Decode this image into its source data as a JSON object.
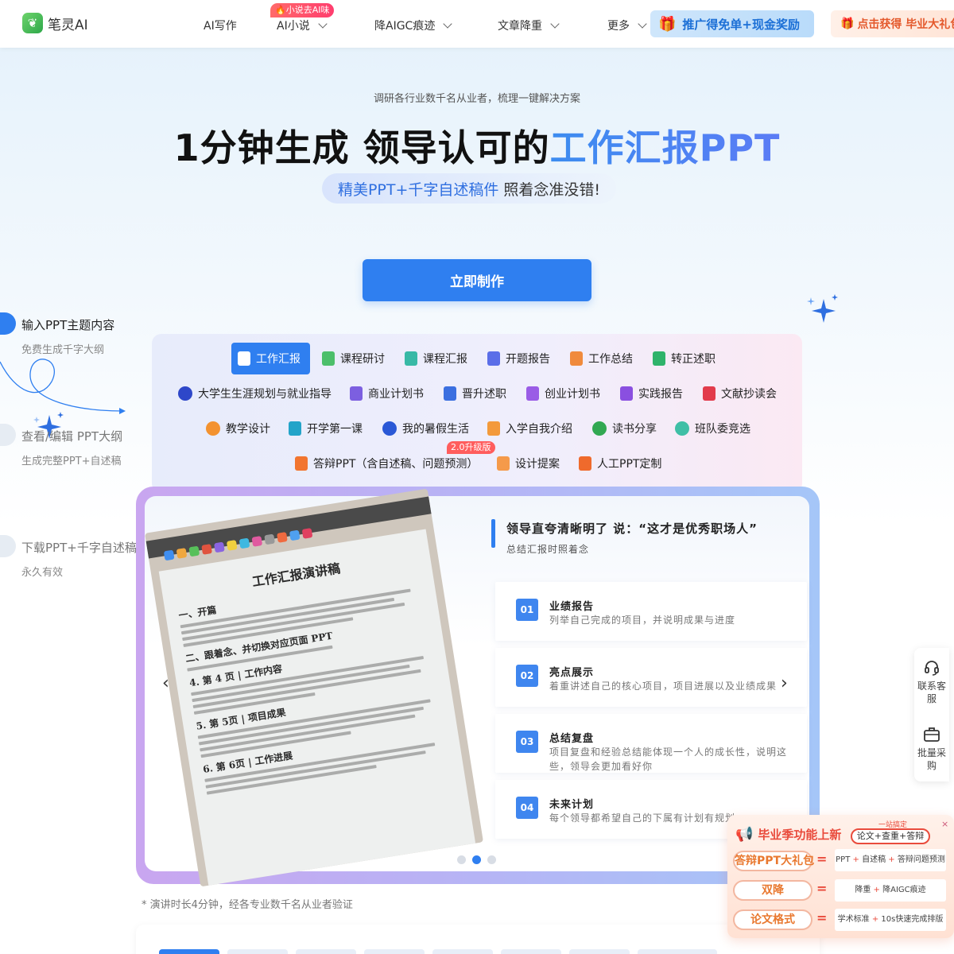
{
  "header": {
    "logo_text": "笔灵AI",
    "nav": [
      {
        "label": "AI写作",
        "dropdown": false
      },
      {
        "label": "AI小说",
        "dropdown": true
      },
      {
        "label": "降AIGC痕迹",
        "dropdown": true
      },
      {
        "label": "文章降重",
        "dropdown": true
      },
      {
        "label": "更多",
        "dropdown": true
      }
    ],
    "hot_badge": "🔥小说去AI味",
    "promo_label": "推广得免单+现金奖励",
    "gift_label": "点击获得 毕业大礼包"
  },
  "hero": {
    "subtitle": "调研各行业数千名从业者，梳理一键解决方案",
    "title_plain": "1分钟生成 领导认可的",
    "title_highlight": "工作汇报PPT",
    "pill_blue": "精美PPT+千字自述稿件",
    "pill_rest": "照着念准没错!",
    "cta": "立即制作"
  },
  "steps": [
    {
      "title": "输入PPT主题内容",
      "desc": "免费生成千字大纲"
    },
    {
      "title": "查看/编辑 PPT大纲",
      "desc": "生成完整PPT+自述稿"
    },
    {
      "title": "下载PPT+千字自述稿",
      "desc": "永久有效"
    }
  ],
  "categories": {
    "row1": [
      "工作汇报",
      "课程研讨",
      "课程汇报",
      "开题报告",
      "工作总结",
      "转正述职"
    ],
    "row2": [
      "大学生生涯规划与就业指导",
      "商业计划书",
      "晋升述职",
      "创业计划书",
      "实践报告",
      "文献抄读会"
    ],
    "row3": [
      "教学设计",
      "开学第一课",
      "我的暑假生活",
      "入学自我介绍",
      "读书分享",
      "班队委竞选"
    ],
    "row4": [
      "答辩PPT（含自述稿、问题预测）",
      "设计提案",
      "人工PPT定制"
    ],
    "new_tag": "2.0升级版"
  },
  "preview": {
    "paper_title": "工作汇报演讲稿",
    "paper_sections": [
      "一、开篇",
      "二、跟着念、并切换对应页面 PPT",
      "4. 第 4 页 | 工作内容",
      "5. 第 5页 | 项目成果",
      "6. 第 6页 | 工作进展"
    ],
    "headline": "领导直夸清晰明了 说：“这才是优秀职场人”",
    "subheadline": "总结汇报时照着念",
    "features": [
      {
        "num": "01",
        "title": "业绩报告",
        "desc": "列举自己完成的项目，并说明成果与进度"
      },
      {
        "num": "02",
        "title": "亮点展示",
        "desc": "着重讲述自己的核心项目，项目进展以及业绩成果"
      },
      {
        "num": "03",
        "title": "总结复盘",
        "desc": "项目复盘和经验总结能体现一个人的成长性，说明这些，领导会更加看好你"
      },
      {
        "num": "04",
        "title": "未来计划",
        "desc": "每个领导都希望自己的下属有计划有规划"
      }
    ],
    "prev_arrow": "‹",
    "next_arrow": "›"
  },
  "footnote": "* 演讲时长4分钟，经各专业数千名从业者验证",
  "side_float": [
    {
      "label": "联系客服",
      "icon": "headset-icon"
    },
    {
      "label": "批量采购",
      "icon": "briefcase-icon"
    }
  ],
  "promo_popup": {
    "headline": "毕业季功能上新",
    "mini": "一站搞定",
    "chip": "论文+查重+答辩",
    "rows": [
      {
        "left": "答辩PPT大礼包",
        "right": [
          "PPT",
          "自述稿",
          "答辩问题预测"
        ]
      },
      {
        "left": "双降",
        "right": [
          "降重",
          "降AIGC痕迹"
        ]
      },
      {
        "left": "论文格式",
        "right": [
          "学术标准",
          "10s快速完成排版"
        ]
      }
    ],
    "eq": "=",
    "close": "×"
  },
  "colors": {
    "accent": "#2f7ff0",
    "promo_red": "#e94b3c"
  }
}
